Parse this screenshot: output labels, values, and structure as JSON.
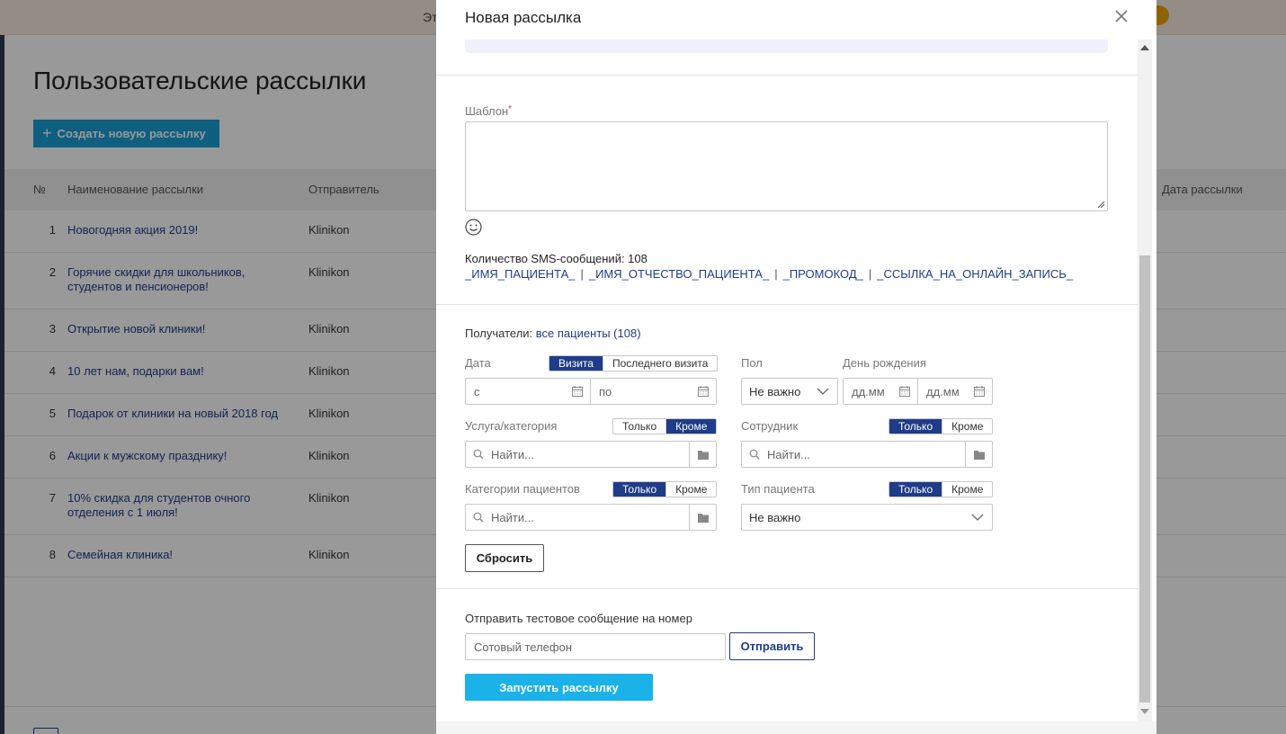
{
  "background": {
    "banner_text": "Эт",
    "page_title": "Пользовательские рассылки",
    "create_button": "Создать новую рассылку",
    "table_headers": {
      "num": "№",
      "name": "Наименование рассылки",
      "sender": "Отправитель",
      "date": "Дата рассылки"
    },
    "rows": [
      {
        "num": "1",
        "name": "Новогодняя акция 2019!",
        "sender": "Klinikon"
      },
      {
        "num": "2",
        "name": "Горячие скидки для школьников, студентов и пенсионеров!",
        "sender": "Klinikon"
      },
      {
        "num": "3",
        "name": "Открытие новой клиники!",
        "sender": "Klinikon"
      },
      {
        "num": "4",
        "name": "10 лет нам, подарки вам!",
        "sender": "Klinikon"
      },
      {
        "num": "5",
        "name": "Подарок от клиники на новый 2018 год",
        "sender": "Klinikon"
      },
      {
        "num": "6",
        "name": "Акции к мужскому празднику!",
        "sender": "Klinikon"
      },
      {
        "num": "7",
        "name": "10% скидка для студентов очного отделения с 1 июля!",
        "sender": "Klinikon"
      },
      {
        "num": "8",
        "name": "Семейная клиника!",
        "sender": "Klinikon"
      }
    ]
  },
  "modal": {
    "title": "Новая рассылка",
    "template_label": "Шаблон",
    "required_mark": "*",
    "sms_count": "Количество SMS-сообщений: 108",
    "variables": [
      "_ИМЯ_ПАЦИЕНТА_",
      "_ИМЯ_ОТЧЕСТВО_ПАЦИЕНТА_",
      "_ПРОМОКОД_",
      "_ССЫЛКА_НА_ОНЛАЙН_ЗАПИСЬ_"
    ],
    "variable_separator": "|",
    "recipients_label": "Получатели:",
    "recipients_value": "все пациенты (108)",
    "date_label": "Дата",
    "date_toggle": [
      "Визита",
      "Последнего визита"
    ],
    "date_from_placeholder": "с",
    "date_to_placeholder": "по",
    "gender_label": "Пол",
    "gender_value": "Не важно",
    "birthday_label": "День рождения",
    "birthday_from_placeholder": "дд.мм",
    "birthday_to_placeholder": "дд.мм",
    "service_label": "Услуга/категория",
    "service_toggle": [
      "Только",
      "Кроме"
    ],
    "service_placeholder": "Найти...",
    "employee_label": "Сотрудник",
    "employee_toggle": [
      "Только",
      "Кроме"
    ],
    "employee_placeholder": "Найти...",
    "patient_cat_label": "Категории пациентов",
    "patient_cat_toggle": [
      "Только",
      "Кроме"
    ],
    "patient_cat_placeholder": "Найти...",
    "patient_type_label": "Тип пациента",
    "patient_type_toggle": [
      "Только",
      "Кроме"
    ],
    "patient_type_value": "Не важно",
    "reset_button": "Сбросить",
    "test_label": "Отправить тестовое сообщение на номер",
    "phone_placeholder": "Сотовый телефон",
    "send_button": "Отправить",
    "launch_button": "Запустить рассылку"
  },
  "colors": {
    "accent": "#1f3c88",
    "primary_button": "#1ab2e8",
    "create_button": "#1a9fd6",
    "required": "#d9304a"
  }
}
